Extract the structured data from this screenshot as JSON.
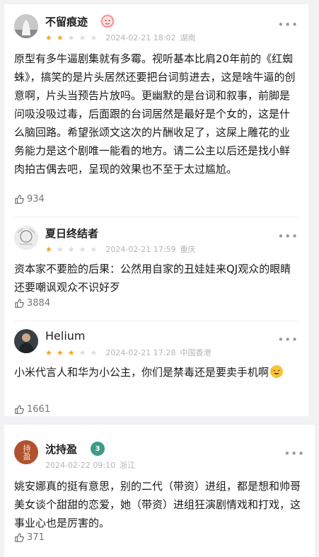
{
  "reviews": [
    {
      "username": "不留痕迹",
      "stars": 2,
      "date": "2024-02-21 18:02",
      "location": "湖南",
      "content": "原型有多牛逼剧集就有多霉。视听基本比肩20年前的《红蜘蛛》，搞笑的是片头居然还要把台词剪进去，这是啥牛逼的创意啊，片头当预告片放吗。更幽默的是台词和叙事，前脚是问吸没吸过毒，后面跟的台词居然是最好是个女的，这是什么脑回路。希望张颂文这次的片酬收足了，这屎上雕花的业务能力是这个剧唯一能看的地方。请二公主以后还是找小鲜肉拍古偶去吧，呈现的效果也不至于太过尴尬。",
      "likes": "934"
    },
    {
      "username": "夏日终结者",
      "stars": 1,
      "date": "2024-02-21 17:59",
      "location": "重庆",
      "content": "资本家不要脸的后果：公然用自家的丑娃娃来QJ观众的眼睛还要嘲讽观众不识好歹",
      "likes": "3884"
    },
    {
      "username": "Helium",
      "stars": 3,
      "date": "2024-02-21 17:28",
      "location": "中国香港",
      "content": "小米代言人和华为小公主，你们是禁毒还是要卖手机啊",
      "likes": "1661"
    },
    {
      "username": "沈持盈",
      "stars": 0,
      "date": "2024-02-22 09:10",
      "location": "浙江",
      "content": "姚安娜真的挺有意思，别的二代（带资）进组，都是想和帅哥美女谈个甜甜的恋爱，她（带资）进组狂演剧情戏和打戏，这事业心也是厉害的。",
      "likes": "371"
    }
  ],
  "badges": {
    "level": "3"
  },
  "colors": {
    "star_on": "#f4a521",
    "star_off": "#dcdcdc",
    "meta": "#b5b5b5"
  },
  "avatar_text": "持盈"
}
